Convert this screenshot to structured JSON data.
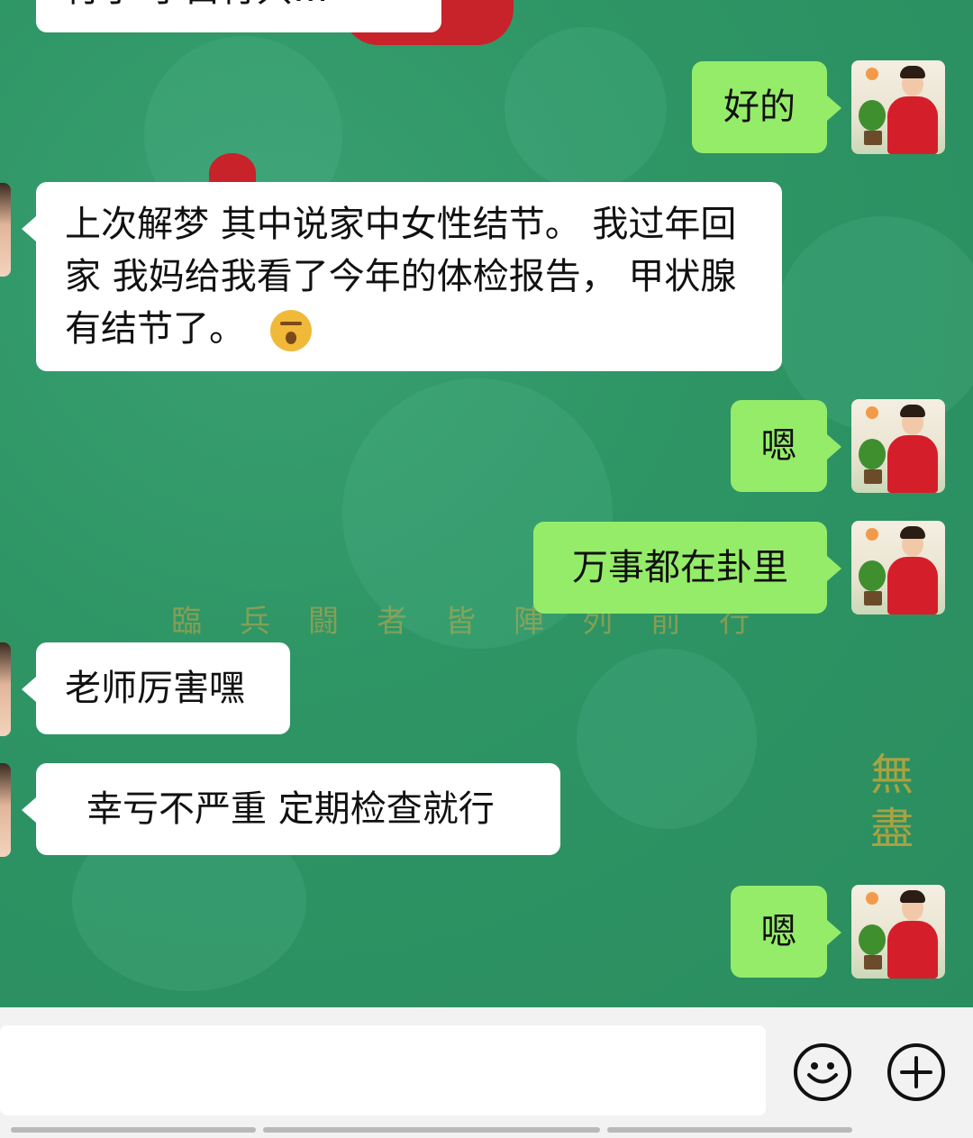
{
  "background": {
    "seal_text": "臨兵闘者皆陣列前行",
    "vertical_text": "無盡"
  },
  "messages": [
    {
      "side": "in",
      "text": "行了 了白行只…"
    },
    {
      "side": "out",
      "text": "好的"
    },
    {
      "side": "in",
      "text": "上次解梦 其中说家中女性结节。 我过年回家 我妈给我看了今年的体检报告， 甲状腺有结节了。",
      "emoji": "kiss-emoji"
    },
    {
      "side": "out",
      "text": "嗯"
    },
    {
      "side": "out",
      "text": "万事都在卦里"
    },
    {
      "side": "in",
      "text": "老师厉害嘿"
    },
    {
      "side": "in",
      "text": "幸亏不严重 定期检查就行"
    },
    {
      "side": "out",
      "text": "嗯"
    }
  ],
  "input_bar": {
    "emoji_icon": "smiley-icon",
    "plus_icon": "plus-icon"
  },
  "colors": {
    "outgoing_bubble": "#95ec69",
    "incoming_bubble": "#ffffff",
    "chat_background": "#2f9466"
  }
}
